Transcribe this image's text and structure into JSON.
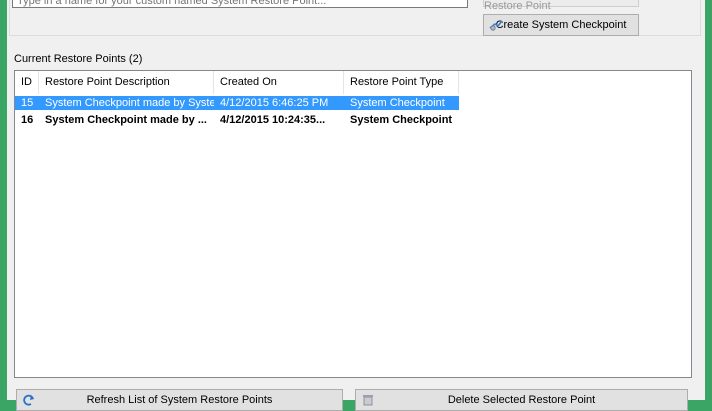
{
  "top": {
    "name_placeholder": "Type in a name for your custom named System Restore Point...",
    "create_custom_label": "Create Custom Named Restore Point",
    "create_system_label": "Create System Checkpoint"
  },
  "restore_points": {
    "section_label": "Current Restore Points (2)",
    "columns": [
      "ID",
      "Restore Point Description",
      "Created On",
      "Restore Point Type"
    ],
    "rows": [
      {
        "id": "15",
        "description": "System Checkpoint made by Syste...",
        "created_on": "4/12/2015 6:46:25 PM",
        "type": "System Checkpoint"
      },
      {
        "id": "16",
        "description": "System Checkpoint made by ...",
        "created_on": "4/12/2015 10:24:35...",
        "type": "System Checkpoint"
      }
    ]
  },
  "bottom": {
    "refresh_label": "Refresh List of System Restore Points",
    "delete_label": "Delete Selected Restore Point"
  },
  "colors": {
    "background": "#3aa565",
    "selection": "#3399ff",
    "window": "#f0f0f0"
  }
}
